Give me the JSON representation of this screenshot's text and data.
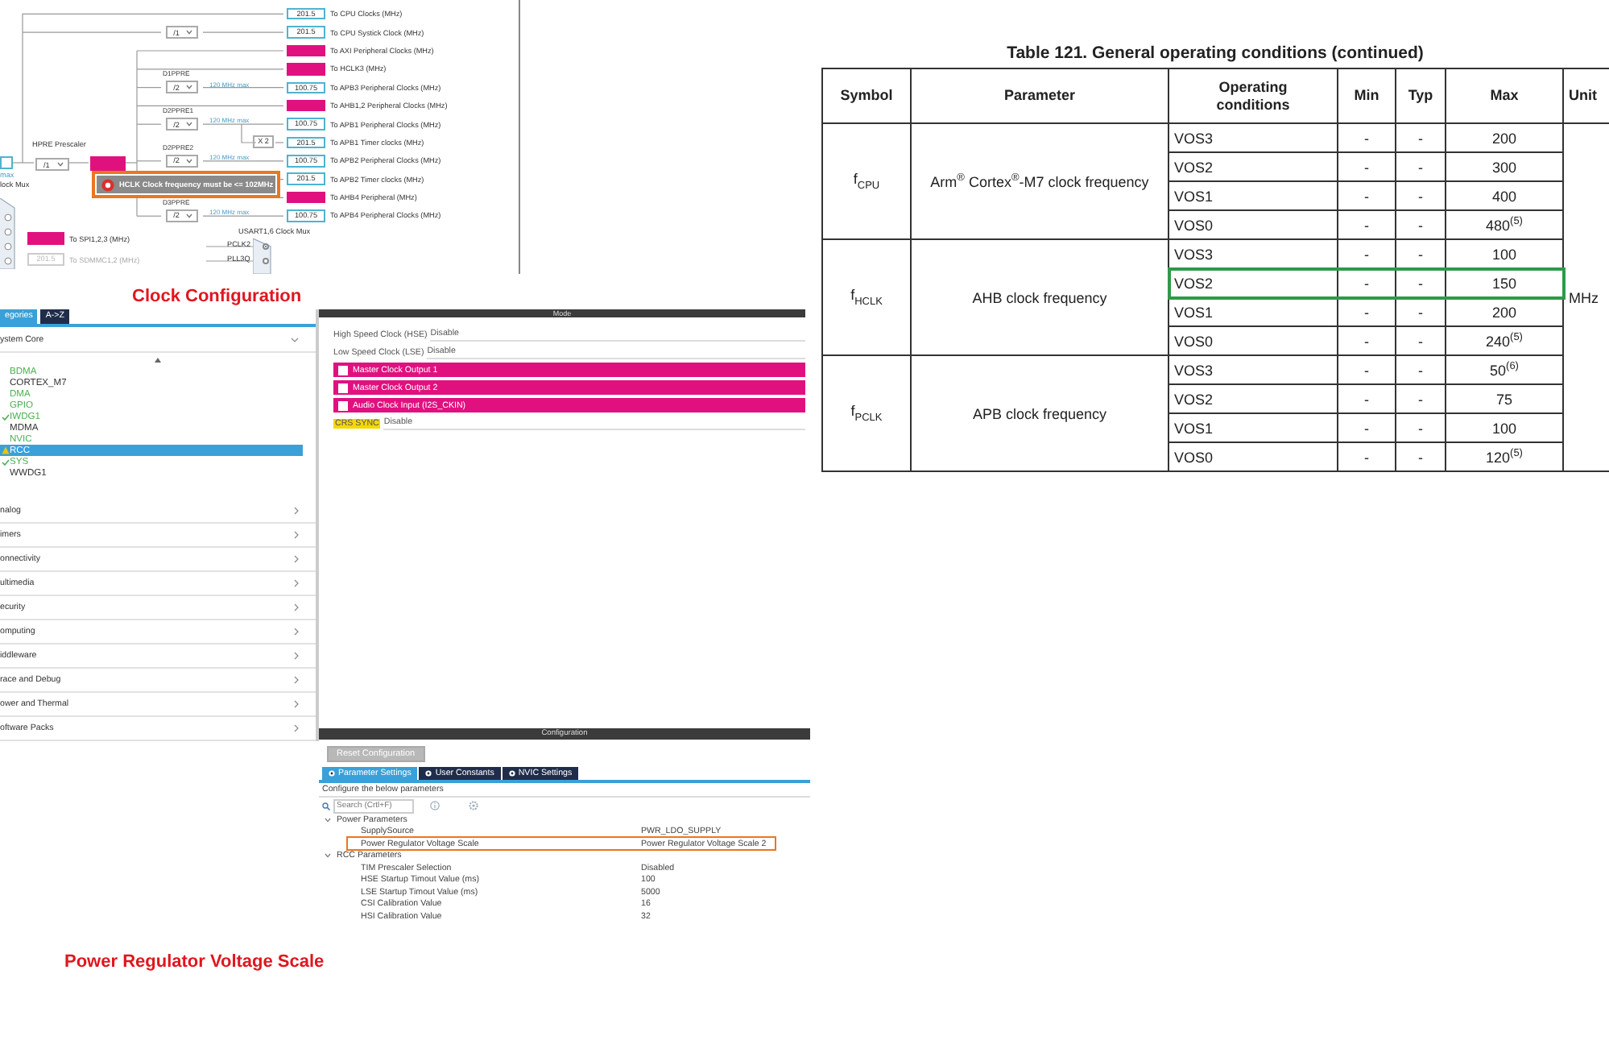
{
  "clock_diagram": {
    "outputs": [
      {
        "value": "201.5",
        "label": "To CPU Clocks (MHz)",
        "alert": false
      },
      {
        "divider": "/1",
        "value": "201.5",
        "label": "To CPU Systick Clock (MHz)",
        "alert": false
      },
      {
        "label": "To AXI Peripheral Clocks (MHz)",
        "alert": true
      },
      {
        "label": "To HCLK3 (MHz)",
        "alert": true
      },
      {
        "prescaler": "D1PPRE",
        "divider": "/2",
        "limit": "120 MHz max",
        "value": "100.75",
        "label": "To APB3 Peripheral Clocks (MHz)",
        "alert": false
      },
      {
        "label": "To AHB1,2 Peripheral Clocks (MHz)",
        "alert": true
      },
      {
        "prescaler": "D2PPRE1",
        "divider": "/2",
        "limit": "120 MHz max",
        "value": "100.75",
        "label": "To APB1 Peripheral Clocks (MHz)",
        "alert": false
      },
      {
        "multiplier": "X 2",
        "value": "201.5",
        "label": "To APB1 Timer clocks (MHz)",
        "alert": false
      },
      {
        "prescaler": "D2PPRE2",
        "divider": "/2",
        "limit": "120 MHz max",
        "value": "100.75",
        "label": "To APB2 Peripheral Clocks (MHz)",
        "alert": false
      },
      {
        "value": "201.5",
        "label": "To APB2 Timer clocks (MHz)",
        "alert": false
      },
      {
        "label": "To AHB4 Peripheral (MHz)",
        "alert": true
      },
      {
        "prescaler": "D3PPRE",
        "divider": "/2",
        "limit": "120 MHz max",
        "value": "100.75",
        "label": "To APB4 Peripheral Clocks (MHz)",
        "alert": false
      }
    ],
    "hpre": {
      "label": "HPRE Prescaler",
      "divider": "/1",
      "alert": true
    },
    "source": {
      "limit": "max",
      "mux": "lock Mux"
    },
    "tooltip": "HCLK Clock frequency must be <= 102MHz",
    "spi": {
      "label": "To SPI1,2,3 (MHz)",
      "alert": true
    },
    "sdmmc": {
      "value": "201.5",
      "label": "To SDMMC1,2 (MHz)",
      "disabled": true
    },
    "usart_mux": {
      "title": "USART1,6 Clock Mux",
      "inputs": [
        {
          "label": "PCLK2",
          "selected": true
        },
        {
          "label": "PLL3Q",
          "selected": false
        }
      ]
    }
  },
  "clock_caption": "Clock Configuration",
  "sidebar": {
    "tabs": [
      {
        "label": "egories",
        "selected": true
      },
      {
        "label": "A->Z",
        "selected": false
      }
    ],
    "group": {
      "label": "ystem Core",
      "expanded": true,
      "items": [
        {
          "label": "BDMA",
          "color": "#4caf50",
          "checked": false,
          "warning": false,
          "selected": false
        },
        {
          "label": "CORTEX_M7",
          "color": "#333333",
          "checked": false,
          "warning": false,
          "selected": false
        },
        {
          "label": "DMA",
          "color": "#4caf50",
          "checked": false,
          "warning": false,
          "selected": false
        },
        {
          "label": "GPIO",
          "color": "#4caf50",
          "checked": false,
          "warning": false,
          "selected": false
        },
        {
          "label": "IWDG1",
          "color": "#4caf50",
          "checked": true,
          "warning": false,
          "selected": false
        },
        {
          "label": "MDMA",
          "color": "#333333",
          "checked": false,
          "warning": false,
          "selected": false
        },
        {
          "label": "NVIC",
          "color": "#4caf50",
          "checked": false,
          "warning": false,
          "selected": false
        },
        {
          "label": "RCC",
          "checked": false,
          "warning": true,
          "selected": true
        },
        {
          "label": "SYS",
          "color": "#4caf50",
          "checked": true,
          "warning": false,
          "selected": false
        },
        {
          "label": "WWDG1",
          "color": "#333333",
          "checked": false,
          "warning": false,
          "selected": false
        }
      ]
    },
    "categories": [
      "nalog",
      "imers",
      "onnectivity",
      "ultimedia",
      "ecurity",
      "omputing",
      "iddleware",
      "race and Debug",
      "ower and Thermal",
      "oftware Packs"
    ]
  },
  "mode": {
    "title": "Mode",
    "fields": [
      {
        "label": "High Speed Clock (HSE)",
        "value": "Disable"
      },
      {
        "label": "Low Speed Clock (LSE)",
        "value": "Disable"
      }
    ],
    "options": [
      {
        "label": "Master Clock Output 1",
        "checked": false
      },
      {
        "label": "Master Clock Output 2",
        "checked": false
      },
      {
        "label": "Audio Clock Input (I2S_CKIN)",
        "checked": false
      }
    ],
    "crs": {
      "label": "CRS SYNC",
      "value": "Disable",
      "warning": true
    }
  },
  "configuration": {
    "title": "Configuration",
    "reset": "Reset Configuration",
    "tabs": [
      {
        "label": "Parameter Settings",
        "selected": true
      },
      {
        "label": "User Constants",
        "selected": false
      },
      {
        "label": "NVIC Settings",
        "selected": false
      }
    ],
    "hint": "Configure the below parameters",
    "search": {
      "placeholder": "Search (Crtl+F)"
    },
    "groups": [
      {
        "label": "Power Parameters",
        "expanded": true,
        "params": [
          {
            "name": "SupplySource",
            "value": "PWR_LDO_SUPPLY",
            "highlighted": false
          },
          {
            "name": "Power Regulator Voltage Scale",
            "value": "Power Regulator Voltage Scale 2",
            "highlighted": true
          }
        ]
      },
      {
        "label": "RCC Parameters",
        "expanded": true,
        "params": [
          {
            "name": "TIM Prescaler Selection",
            "value": "Disabled",
            "highlighted": false
          },
          {
            "name": "HSE Startup Timout Value (ms)",
            "value": "100",
            "highlighted": false
          },
          {
            "name": "LSE Startup Timout Value (ms)",
            "value": "5000",
            "highlighted": false
          },
          {
            "name": "CSI Calibration Value",
            "value": "16",
            "highlighted": false
          },
          {
            "name": "HSI Calibration Value",
            "value": "32",
            "highlighted": false
          }
        ]
      }
    ]
  },
  "power_caption": "Power Regulator Voltage Scale",
  "spec_table": {
    "title": "Table 121. General operating conditions (continued)",
    "columns": [
      "Symbol",
      "Parameter",
      "Operating conditions",
      "Min",
      "Typ",
      "Max",
      "Unit"
    ],
    "unit": "MHz",
    "groups": [
      {
        "symbol": "f$_{CPU}$",
        "parameter": "Arm$^{®}$ Cortex$^{®}$-M7 clock frequency",
        "rows": [
          {
            "condition": "VOS3",
            "min": "-",
            "typ": "-",
            "max": "200",
            "highlighted": false
          },
          {
            "condition": "VOS2",
            "min": "-",
            "typ": "-",
            "max": "300",
            "highlighted": false
          },
          {
            "condition": "VOS1",
            "min": "-",
            "typ": "-",
            "max": "400",
            "highlighted": false
          },
          {
            "condition": "VOS0",
            "min": "-",
            "typ": "-",
            "max": "480$^{(5)}$",
            "highlighted": false
          }
        ]
      },
      {
        "symbol": "f$_{HCLK}$",
        "parameter": "AHB clock frequency",
        "rows": [
          {
            "condition": "VOS3",
            "min": "-",
            "typ": "-",
            "max": "100",
            "highlighted": false
          },
          {
            "condition": "VOS2",
            "min": "-",
            "typ": "-",
            "max": "150",
            "highlighted": true
          },
          {
            "condition": "VOS1",
            "min": "-",
            "typ": "-",
            "max": "200",
            "highlighted": false
          },
          {
            "condition": "VOS0",
            "min": "-",
            "typ": "-",
            "max": "240$^{(5)}$",
            "highlighted": false
          }
        ]
      },
      {
        "symbol": "f$_{PCLK}$",
        "parameter": "APB clock frequency",
        "rows": [
          {
            "condition": "VOS3",
            "min": "-",
            "typ": "-",
            "max": "50$^{(6)}$",
            "highlighted": false
          },
          {
            "condition": "VOS2",
            "min": "-",
            "typ": "-",
            "max": "75",
            "highlighted": false
          },
          {
            "condition": "VOS1",
            "min": "-",
            "typ": "-",
            "max": "100",
            "highlighted": false
          },
          {
            "condition": "VOS0",
            "min": "-",
            "typ": "-",
            "max": "120$^{(5)}$",
            "highlighted": false
          }
        ]
      }
    ]
  }
}
